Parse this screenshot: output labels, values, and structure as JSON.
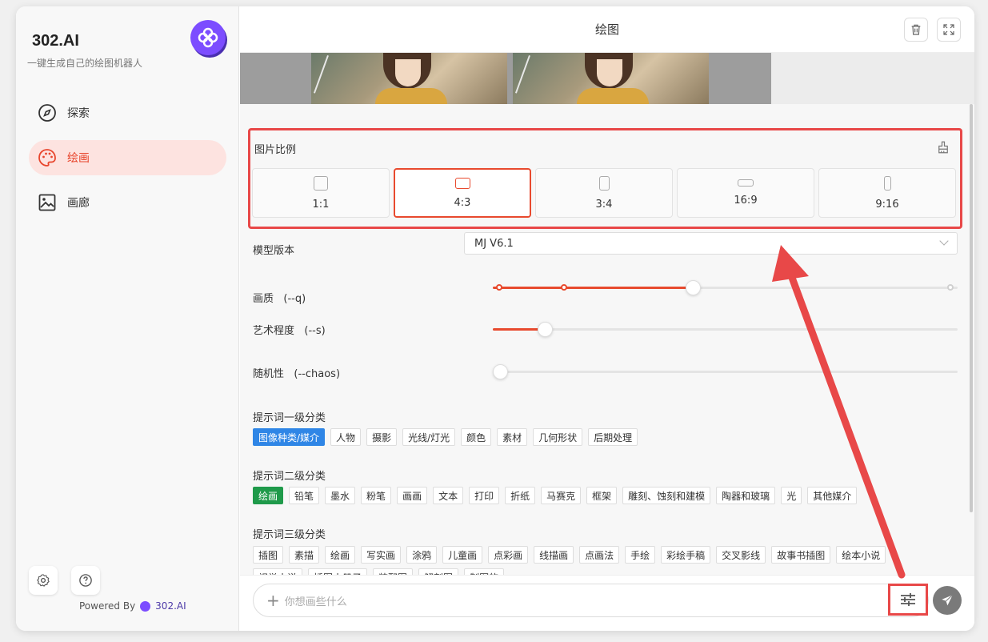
{
  "sidebar": {
    "brand_title": "302.AI",
    "brand_subtitle": "一键生成自己的绘图机器人",
    "nav": [
      {
        "label": "探索",
        "icon": "compass-icon",
        "active": false
      },
      {
        "label": "绘画",
        "icon": "palette-icon",
        "active": true
      },
      {
        "label": "画廊",
        "icon": "image-icon",
        "active": false
      }
    ],
    "powered_by_label": "Powered By",
    "powered_by_brand": "302.AI"
  },
  "header": {
    "title": "绘图"
  },
  "ratio": {
    "title": "图片比例",
    "options": [
      {
        "label": "1:1",
        "active": false
      },
      {
        "label": "4:3",
        "active": true
      },
      {
        "label": "3:4",
        "active": false
      },
      {
        "label": "16:9",
        "active": false
      },
      {
        "label": "9:16",
        "active": false
      }
    ]
  },
  "model": {
    "label": "模型版本",
    "value": "MJ V6.1"
  },
  "sliders": {
    "quality": {
      "label": "画质",
      "param": "(--q)",
      "fraction": 0.43
    },
    "stylize": {
      "label": "艺术程度",
      "param": "(--s)",
      "fraction": 0.113
    },
    "chaos": {
      "label": "随机性",
      "param": "(--chaos)",
      "fraction": 0.0
    }
  },
  "level1": {
    "title": "提示词一级分类",
    "tags": [
      "图像种类/媒介",
      "人物",
      "摄影",
      "光线/灯光",
      "颜色",
      "素材",
      "几何形状",
      "后期处理"
    ],
    "selected": "图像种类/媒介"
  },
  "level2": {
    "title": "提示词二级分类",
    "tags": [
      "绘画",
      "铅笔",
      "墨水",
      "粉笔",
      "画画",
      "文本",
      "打印",
      "折纸",
      "马赛克",
      "框架",
      "雕刻、蚀刻和建模",
      "陶器和玻璃",
      "光",
      "其他媒介"
    ],
    "selected": "绘画"
  },
  "level3": {
    "title": "提示词三级分类",
    "tags": [
      "插图",
      "素描",
      "绘画",
      "写实画",
      "涂鸦",
      "儿童画",
      "点彩画",
      "线描画",
      "点画法",
      "手绘",
      "彩绘手稿",
      "交叉影线",
      "故事书插图",
      "绘本小说"
    ],
    "tags_row2": [
      "视觉小说",
      "插图小册子",
      "装配图",
      "解剖图",
      "制图的"
    ]
  },
  "composer": {
    "placeholder": "你想画些什么"
  },
  "colors": {
    "accent": "#e84a2e",
    "highlight_box": "#e84848",
    "brand": "#7c4dff",
    "tag_blue": "#2f86e6",
    "tag_green": "#1f9a4a"
  }
}
